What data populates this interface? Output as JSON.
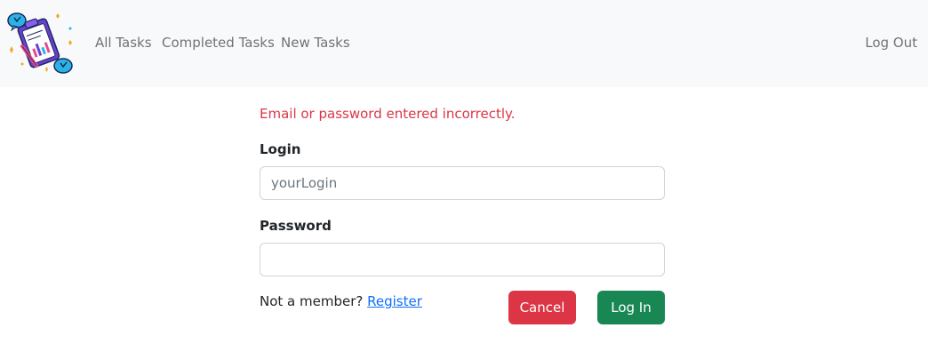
{
  "navbar": {
    "logo_icon": "clipboard-checklist-logo",
    "links": [
      {
        "label": "All Tasks"
      },
      {
        "label": "Completed Tasks"
      },
      {
        "label": "New Tasks"
      }
    ],
    "logout_label": "Log Out"
  },
  "form": {
    "error_message": "Email or password entered incorrectly.",
    "login_label": "Login",
    "login_placeholder": "yourLogin",
    "login_value": "",
    "password_label": "Password",
    "password_value": "",
    "member_prompt": "Not a member?",
    "register_label": "Register",
    "cancel_label": "Cancel",
    "submit_label": "Log In"
  },
  "colors": {
    "navbar_bg": "#f8f9fa",
    "error": "#dc3545",
    "cancel": "#dc3545",
    "submit": "#198754",
    "link": "#0d6efd"
  }
}
